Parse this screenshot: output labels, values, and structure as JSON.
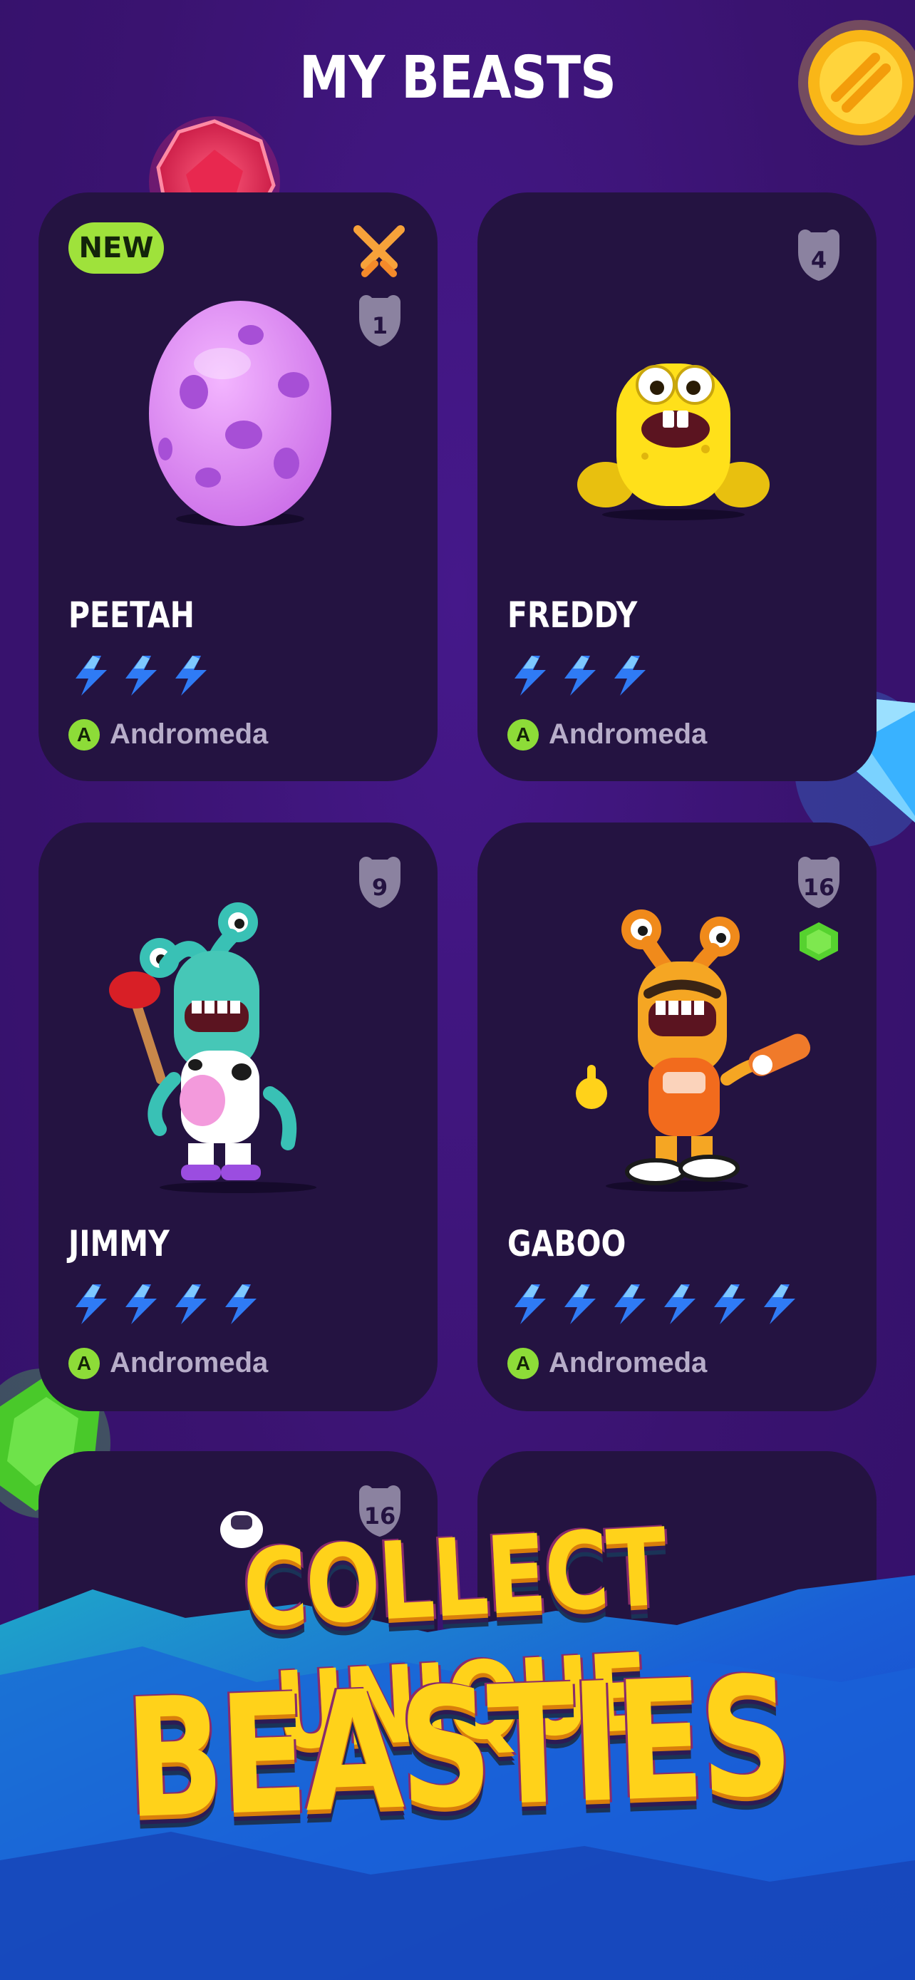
{
  "header": {
    "title": "MY BEASTS"
  },
  "badges": {
    "new": "NEW"
  },
  "beasts": [
    {
      "name": "PEETAH",
      "level": "1",
      "power": 3,
      "origin_letter": "A",
      "origin": "Andromeda",
      "is_new": true,
      "status_icon": "crossed-swords-icon"
    },
    {
      "name": "FREDDY",
      "level": "4",
      "power": 3,
      "origin_letter": "A",
      "origin": "Andromeda"
    },
    {
      "name": "JIMMY",
      "level": "9",
      "power": 4,
      "origin_letter": "A",
      "origin": "Andromeda"
    },
    {
      "name": "GABOO",
      "level": "16",
      "power": 6,
      "origin_letter": "A",
      "origin": "Andromeda",
      "gem_icon": "green-gem-icon"
    },
    {
      "level": "16"
    }
  ],
  "promo": {
    "line1": "COLLECT UNIQUE",
    "line2": "BEASTIES"
  },
  "colors": {
    "background": "#3d1473",
    "card": "#241341",
    "accent_green": "#9fe23b",
    "bolt_blue": "#2f7bf5",
    "headline_yellow": "#ffd21a"
  }
}
